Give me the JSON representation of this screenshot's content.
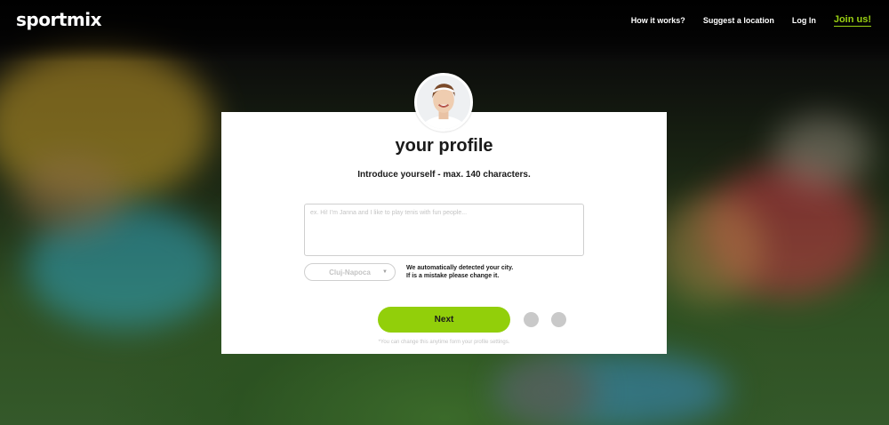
{
  "header": {
    "logo": "sportmix",
    "nav": [
      {
        "label": "How it works?"
      },
      {
        "label": "Suggest a location"
      },
      {
        "label": "Log In"
      },
      {
        "label": "Join us!"
      }
    ]
  },
  "profile": {
    "title": "your profile",
    "subtitle": "Introduce yourself - max. 140 characters.",
    "intro_placeholder": "ex. Hi! I'm Janna and I like to play tenis with fun people...",
    "city": "Cluj-Napoca",
    "city_note_line1": "We automatically detected your city.",
    "city_note_line2": "If is a mistake please change it.",
    "next_label": "Next",
    "footnote": "*You can change this anytime form your profile settings."
  },
  "colors": {
    "accent": "#92cf0a",
    "link_accent": "#9ad113"
  },
  "icons": {
    "avatar": "profile-photo",
    "select_arrow": "chevron-down"
  }
}
